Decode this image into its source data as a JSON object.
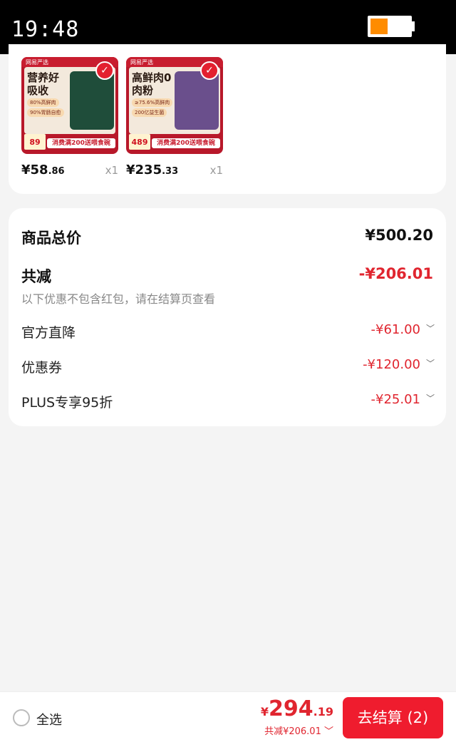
{
  "status_bar": {
    "time": "19:48",
    "battery_level": 0.45
  },
  "products": [
    {
      "thumb_brand": "网易严选",
      "thumb_headline": "营养好吸收",
      "thumb_tag1": "80%高鲜肉",
      "thumb_tag2": "90%胃肠自愈",
      "thumb_price": "89",
      "thumb_banner": "消费满200送喂食碗",
      "thumb_bag_color": "#1f4d3a",
      "price_int": "¥58",
      "price_dec": ".86",
      "qty": "x1"
    },
    {
      "thumb_brand": "网易严选",
      "thumb_headline": "高鲜肉0肉粉",
      "thumb_tag1": "≥75.6%高鲜肉",
      "thumb_tag2": "200亿益生菌",
      "thumb_price": "489",
      "thumb_banner": "消费满200送喂食碗",
      "thumb_bag_color": "#6a4f8c",
      "price_int": "¥235",
      "price_dec": ".33",
      "qty": "x1"
    }
  ],
  "summary": {
    "goods_total_label": "商品总价",
    "goods_total_value": "¥500.20",
    "total_reduction_label": "共减",
    "total_reduction_value": "-¥206.01",
    "note": "以下优惠不包含红包，请在结算页查看",
    "items": [
      {
        "label": "官方直降",
        "value": "-¥61.00"
      },
      {
        "label": "优惠券",
        "value": "-¥120.00"
      },
      {
        "label": "PLUS专享95折",
        "value": "-¥25.01"
      }
    ]
  },
  "bottom_bar": {
    "select_all_label": "全选",
    "total_currency": "¥",
    "total_int": "294",
    "total_dec": ".19",
    "total_discount": "共减¥206.01",
    "checkout_label": "去结算 (2)"
  },
  "colors": {
    "accent_red": "#e0252f",
    "checkout_red": "#ef1c2e"
  }
}
